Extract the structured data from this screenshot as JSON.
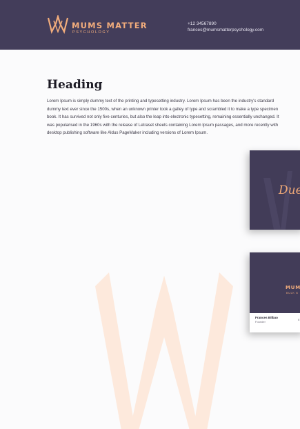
{
  "header": {
    "brand_name": "MUMS MATTER",
    "brand_sub": "PSYCHOLOGY",
    "phone": "+12 34567890",
    "email": "frances@mumsmatterpsychology.com"
  },
  "content": {
    "heading": "Heading",
    "body": "Lorem Ipsum is simply dummy text of the printing and typesetting industry. Lorem Ipsum has been the industry's standard dummy text ever since the 1500s, when an unknown printer took a galley of type and scrambled it to make a type specimen book. It has survived not only five centuries, but also the leap into electronic typesetting, remaining essentially unchanged. It was popularised in the 1960s with the release of Letraset sheets containing Lorem Ipsum passages, and more recently with desktop publishing software like Aldus PageMaker including versions of Lorem Ipsum."
  },
  "card_front": {
    "text": "Due"
  },
  "card_back": {
    "brand": "MUM",
    "sub": "BULK B",
    "name": "Frances Bilbao",
    "role": "Founder",
    "extra": "E"
  },
  "colors": {
    "brand_purple": "#433d5a",
    "brand_peach": "#f2ad7c",
    "watermark": "#fde9dc"
  },
  "icons": {
    "logo": "crown-logo-icon",
    "watermark": "crown-watermark-icon"
  }
}
